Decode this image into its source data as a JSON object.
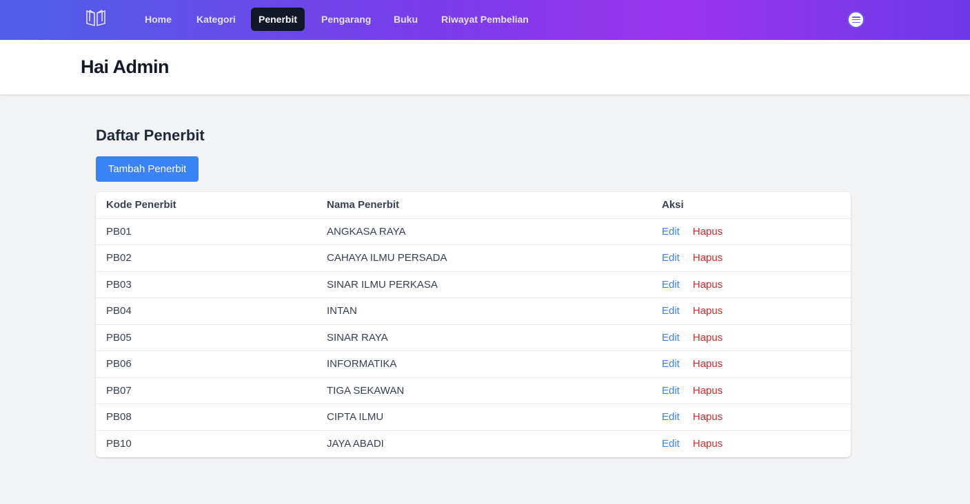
{
  "nav": {
    "logo_icon": "book-icon",
    "items": [
      {
        "label": "Home",
        "active": false
      },
      {
        "label": "Kategori",
        "active": false
      },
      {
        "label": "Penerbit",
        "active": true
      },
      {
        "label": "Pengarang",
        "active": false
      },
      {
        "label": "Buku",
        "active": false
      },
      {
        "label": "Riwayat Pembelian",
        "active": false
      }
    ],
    "profile_icon": "menu-icon"
  },
  "header": {
    "title": "Hai Admin"
  },
  "main": {
    "section_title": "Daftar Penerbit",
    "add_button_label": "Tambah Penerbit",
    "table": {
      "columns": [
        "Kode Penerbit",
        "Nama Penerbit",
        "Aksi"
      ],
      "edit_label": "Edit",
      "delete_label": "Hapus",
      "rows": [
        {
          "kode": "PB01",
          "nama": "ANGKASA RAYA"
        },
        {
          "kode": "PB02",
          "nama": "CAHAYA ILMU PERSADA"
        },
        {
          "kode": "PB03",
          "nama": "SINAR ILMU PERKASA"
        },
        {
          "kode": "PB04",
          "nama": "INTAN"
        },
        {
          "kode": "PB05",
          "nama": "SINAR RAYA"
        },
        {
          "kode": "PB06",
          "nama": "INFORMATIKA"
        },
        {
          "kode": "PB07",
          "nama": "TIGA SEKAWAN"
        },
        {
          "kode": "PB08",
          "nama": "CIPTA ILMU"
        },
        {
          "kode": "PB10",
          "nama": "JAYA ABADI"
        }
      ]
    }
  },
  "colors": {
    "nav_gradient_start": "#4f5fe8",
    "nav_gradient_mid": "#9b34ec",
    "active_nav": "#111827",
    "primary_button": "#3b82f6",
    "edit_link": "#3b82f6",
    "delete_link": "#dc2626"
  }
}
